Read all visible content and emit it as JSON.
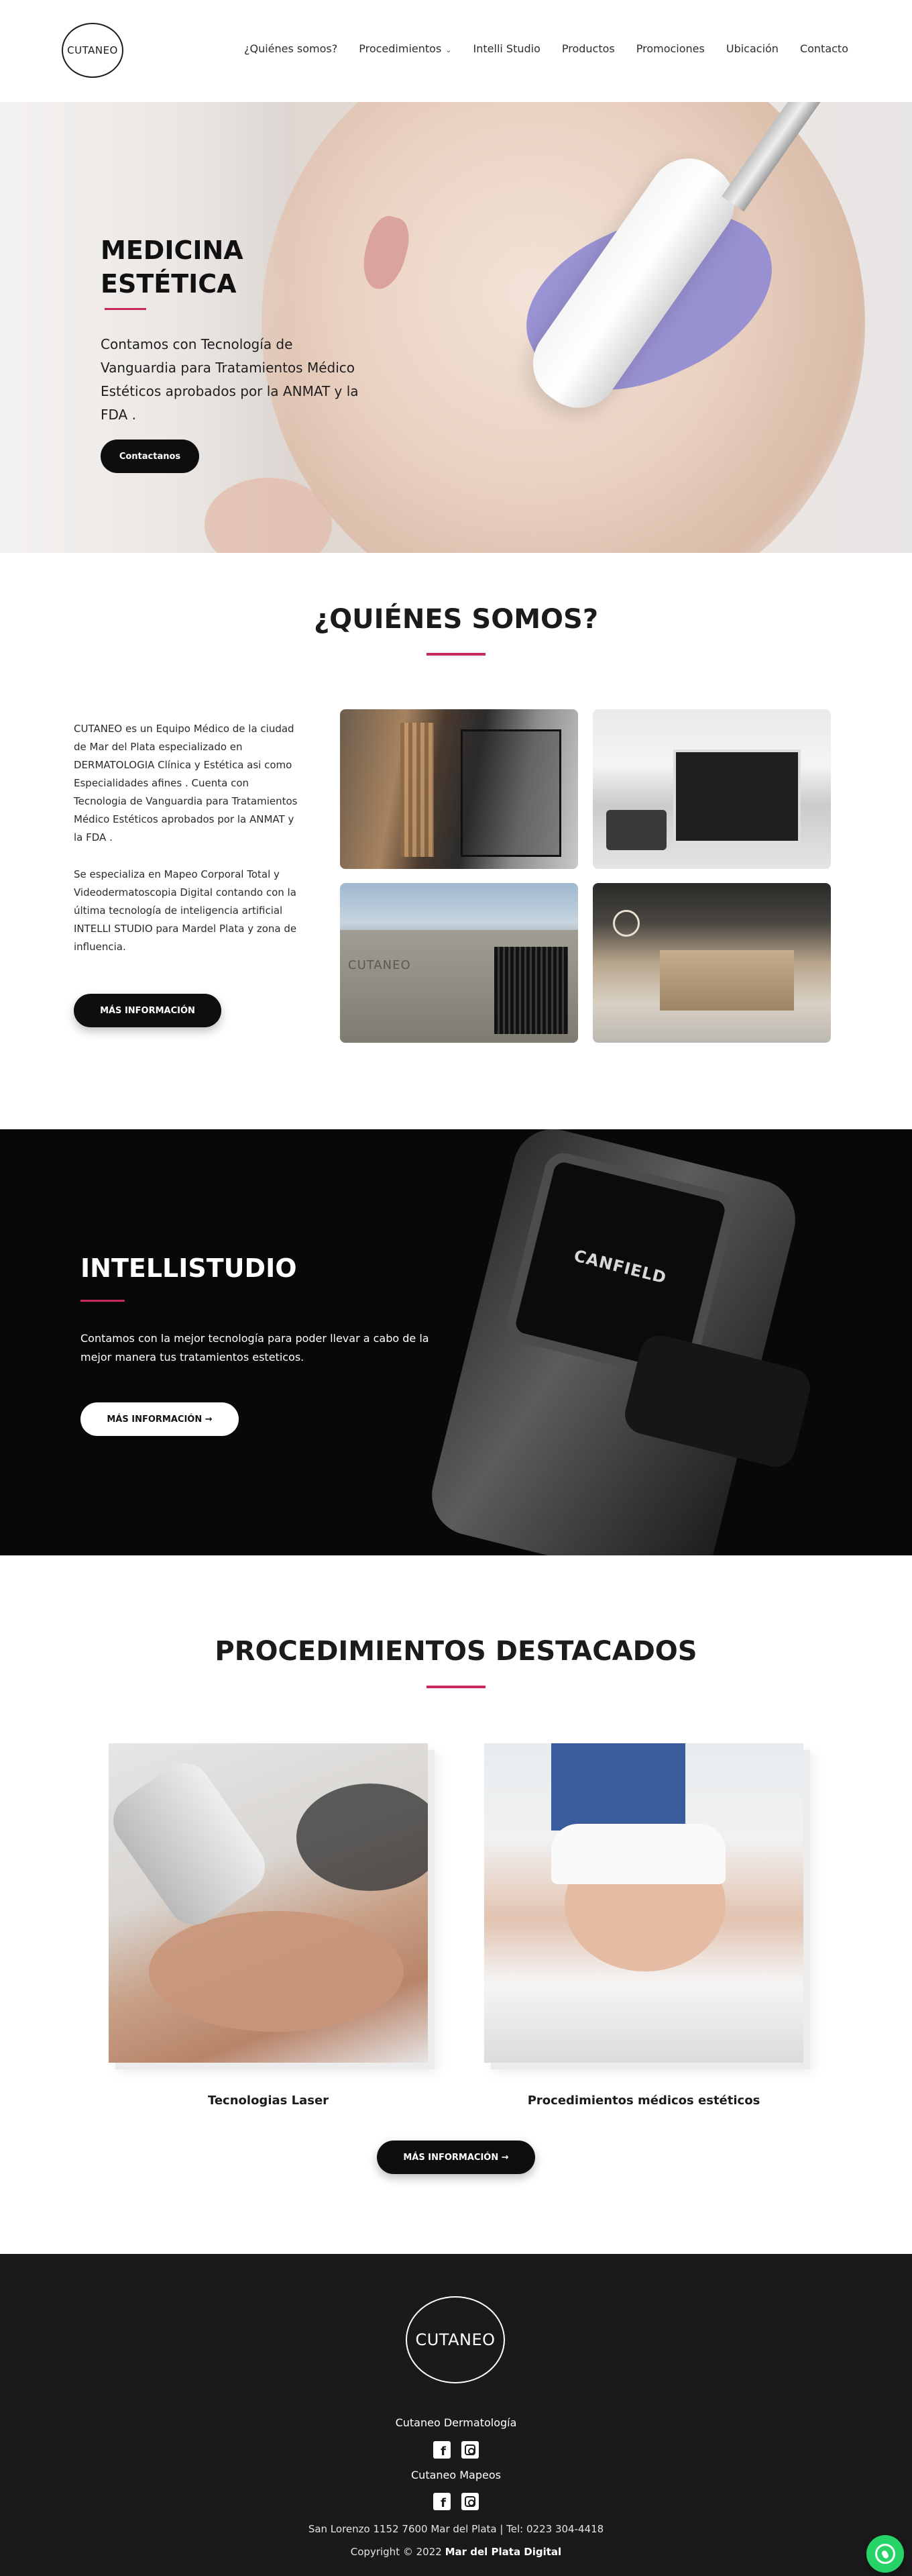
{
  "header": {
    "logo_text": "CUTANEO",
    "nav": [
      {
        "label": "¿Quiénes somos?"
      },
      {
        "label": "Procedimientos",
        "has_dropdown": true
      },
      {
        "label": "Intelli Studio"
      },
      {
        "label": "Productos"
      },
      {
        "label": "Promociones"
      },
      {
        "label": "Ubicación"
      },
      {
        "label": "Contacto"
      }
    ],
    "dropdown_icon": "chevron-down-icon"
  },
  "hero": {
    "title": "MEDICINA ESTÉTICA",
    "text": "Contamos con Tecnología de Vanguardia para Tratamientos Médico Estéticos aprobados por la ANMAT y la FDA .",
    "button_label": "Contactanos",
    "slides_count": 4,
    "active_slide": 1
  },
  "quienes": {
    "title": "¿QUIÉNES SOMOS?",
    "para1": "CUTANEO  es un Equipo Médico de la ciudad de Mar del Plata  especializado en DERMATOLOGIA Clínica y Estética  asi como Especialidades afines . Cuenta con Tecnologia de Vanguardia para Tratamientos Médico Estéticos  aprobados por la  ANMAT y la FDA .",
    "para2": "Se especializa en Mapeo Corporal Total y Videodermatoscopia Digital contando con la última tecnología de inteligencia artificial  INTELLI STUDIO para  Mardel Plata y zona de influencia.",
    "button_label": "MÁS INFORMACIÓN",
    "photo_label": "CUTANEO"
  },
  "intelli": {
    "title": "INTELLISTUDIO",
    "text": "Contamos con la mejor tecnología para poder llevar a cabo de la mejor manera tus tratamientos esteticos.",
    "button_label": "MÁS INFORMACIÓN →",
    "device_brand": "CANFIELD"
  },
  "procedimientos": {
    "title": "PROCEDIMIENTOS DESTACADOS",
    "cards": [
      {
        "caption": "Tecnologias Laser"
      },
      {
        "caption": "Procedimientos médicos estéticos"
      }
    ],
    "button_label": "MÁS INFORMACIÓN →"
  },
  "footer": {
    "logo_text": "CUTANEO",
    "label1": "Cutaneo Dermatología",
    "label2": "Cutaneo Mapeos",
    "address": "San Lorenzo 1152 7600 Mar del Plata | Tel: 0223 304-4418",
    "copyright_prefix": "Copyright © 2022",
    "copyright_brand": "Mar del Plata Digital",
    "social_icons": [
      "facebook-icon",
      "instagram-icon"
    ],
    "chat_icon": "whatsapp-icon"
  },
  "colors": {
    "accent": "#c8285e",
    "dark": "#0e0e0e",
    "footer_bg": "#1a1a1a",
    "whatsapp": "#25d366"
  }
}
